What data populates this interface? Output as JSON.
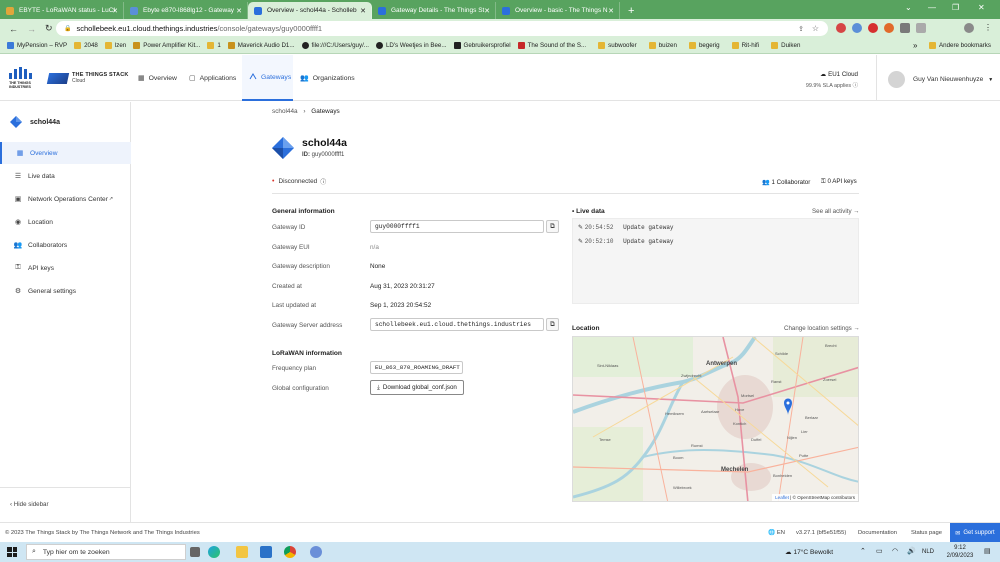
{
  "browser": {
    "tabs": [
      {
        "title": "EBYTE - LoRaWAN status - LuCI",
        "active": false,
        "favicon_color": "#e0a63b"
      },
      {
        "title": "Ebyte e870-l868lg12 - Gateway",
        "active": false,
        "favicon_color": "#5a8fd8"
      },
      {
        "title": "Overview - schol44a - Scholleb",
        "active": true,
        "favicon_color": "#2b6fdc"
      },
      {
        "title": "Gateway Details - The Things St",
        "active": false,
        "favicon_color": "#2b6fdc"
      },
      {
        "title": "Overview - basic - The Things N",
        "active": false,
        "favicon_color": "#2b6fdc"
      }
    ],
    "new_tab": "+",
    "url_domain": "schollebeek.eu1.cloud.thethings.industries",
    "url_path": "/console/gateways/guy0000ffff1",
    "bookmarks": [
      {
        "label": "MyPension – RVP"
      },
      {
        "label": "2048"
      },
      {
        "label": "lzen"
      },
      {
        "label": "Power Amplifier Kit..."
      },
      {
        "label": "1"
      },
      {
        "label": "Maverick Audio D1..."
      },
      {
        "label": "file:///C:/Users/guy/..."
      },
      {
        "label": "LD's Weetjes in Bee..."
      },
      {
        "label": "Gebruikersprofiel"
      },
      {
        "label": "The Sound of the S..."
      },
      {
        "label": "subwoofer"
      },
      {
        "label": "buizen"
      },
      {
        "label": "begerig"
      },
      {
        "label": "Rit-hifi"
      },
      {
        "label": "Duiken"
      }
    ],
    "bookmarks_more": "»",
    "other_bookmarks": "Andere bookmarks"
  },
  "header": {
    "logo_text_1": "THE THINGS",
    "logo_text_2": "INDUSTRIES",
    "brand_title": "THE THINGS STACK",
    "brand_sub": "Cloud",
    "nav": [
      {
        "label": "Overview",
        "icon": "grid-icon",
        "glyph": "▦",
        "active": false
      },
      {
        "label": "Applications",
        "icon": "apps-icon",
        "glyph": "▢",
        "active": false
      },
      {
        "label": "Gateways",
        "icon": "gateway-icon",
        "glyph": "",
        "active": true
      },
      {
        "label": "Organizations",
        "icon": "people-icon",
        "glyph": "👥",
        "active": false
      }
    ],
    "cluster": "EU1 Cloud",
    "sla": "99.9% SLA applies",
    "user": "Guy Van Nieuwenhuyze"
  },
  "sidebar": {
    "gateway_name": "schol44a",
    "items": [
      {
        "label": "Overview",
        "icon": "grid-icon",
        "glyph": "▦",
        "active": true
      },
      {
        "label": "Live data",
        "icon": "list-icon",
        "glyph": "☰",
        "active": false
      },
      {
        "label": "Network Operations Center",
        "icon": "noc-icon",
        "glyph": "▣",
        "active": false,
        "external": "↗"
      },
      {
        "label": "Location",
        "icon": "location-icon",
        "glyph": "◉",
        "active": false
      },
      {
        "label": "Collaborators",
        "icon": "people-icon",
        "glyph": "👥",
        "active": false
      },
      {
        "label": "API keys",
        "icon": "key-icon",
        "glyph": "⚿",
        "active": false
      },
      {
        "label": "General settings",
        "icon": "gear-icon",
        "glyph": "⚙",
        "active": false
      }
    ],
    "hide": "Hide sidebar"
  },
  "breadcrumb": [
    "schol44a",
    "Gateways"
  ],
  "gateway": {
    "name": "schol44a",
    "id_label": "ID:",
    "id": "guy0000ffff1",
    "status": "Disconnected",
    "collaborators": "1 Collaborator",
    "api_keys": "0 API keys"
  },
  "general": {
    "title": "General information",
    "rows": [
      {
        "label": "Gateway ID",
        "value": "guy0000ffff1",
        "type": "field"
      },
      {
        "label": "Gateway EUI",
        "value": "n/a",
        "type": "muted"
      },
      {
        "label": "Gateway description",
        "value": "None",
        "type": "text"
      },
      {
        "label": "Created at",
        "value": "Aug 31, 2023 20:31:27",
        "type": "text"
      },
      {
        "label": "Last updated at",
        "value": "Sep 1, 2023 20:54:52",
        "type": "text"
      },
      {
        "label": "Gateway Server address",
        "value": "schollebeek.eu1.cloud.thethings.industries",
        "type": "field"
      }
    ]
  },
  "lorawan": {
    "title": "LoRaWAN information",
    "freq_label": "Frequency plan",
    "freq_value": "EU_863_870_ROAMING_DRAFT",
    "global_label": "Global configuration",
    "download": "Download global_conf.json"
  },
  "live": {
    "title": "Live data",
    "see_all": "See all activity →",
    "events": [
      {
        "time": "20:54:52",
        "text": "Update gateway"
      },
      {
        "time": "20:52:10",
        "text": "Update gateway"
      }
    ]
  },
  "location": {
    "title": "Location",
    "change": "Change location settings →",
    "places": [
      "Antwerpen",
      "Mechelen",
      "Schilde",
      "Lier",
      "Boom",
      "Kontich",
      "Duffel",
      "Hove",
      "Mortsel",
      "Brecht",
      "Zwijndrecht",
      "Willebroek",
      "Bonheiden",
      "Putte",
      "Ranst",
      "Zoersel",
      "Berlaar",
      "Nijlen",
      "Hemiksem",
      "Temse",
      "Sint-Niklaas",
      "Aartselaar",
      "Rumst"
    ],
    "attribution_leaflet": "Leaflet",
    "attribution_osm": "© OpenStreetMap contributors"
  },
  "footer": {
    "copyright": "© 2023 The Things Stack by The Things Network and The Things Industries",
    "lang": "EN",
    "version": "v3.27.1 (bf5e51f55)",
    "docs": "Documentation",
    "status": "Status page",
    "support": "Get support"
  },
  "taskbar": {
    "search": "Typ hier om te zoeken",
    "weather": "17°C  Bewolkt",
    "lang": "NLD",
    "time": "9:12",
    "date": "2/09/2023"
  }
}
